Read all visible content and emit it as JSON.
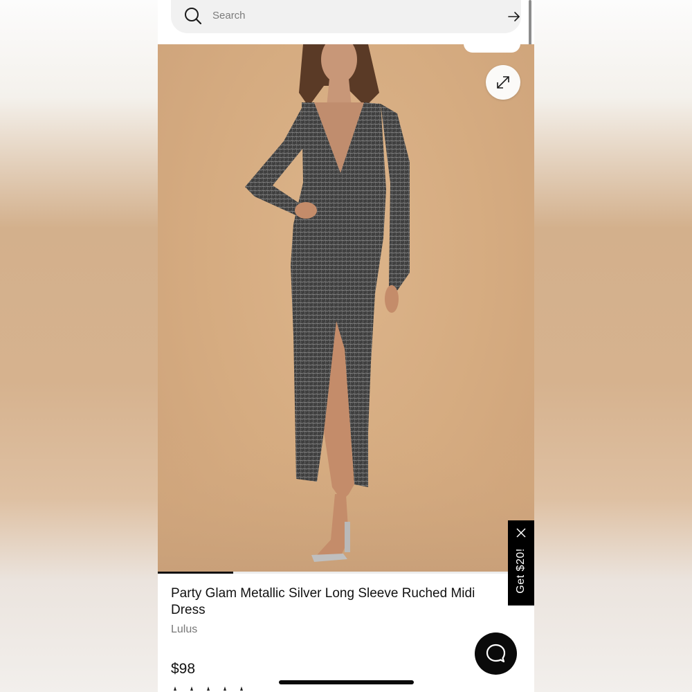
{
  "search": {
    "placeholder": "Search"
  },
  "image_carousel": {
    "progress_fraction": 0.2,
    "expand_icon": "expand-arrows-icon"
  },
  "product": {
    "title": "Party Glam Metallic Silver Long Sleeve Ruched Midi Dress",
    "brand": "Lulus",
    "price": "$98"
  },
  "promo": {
    "label": "Get $20!",
    "close_icon": "close-icon"
  },
  "chat": {
    "icon": "chat-bubble-icon"
  },
  "colors": {
    "image_background": "#d5ab80",
    "dress": "#4a4a4a",
    "text_primary": "#111111",
    "text_secondary": "#777777",
    "promo_background": "#000000"
  }
}
